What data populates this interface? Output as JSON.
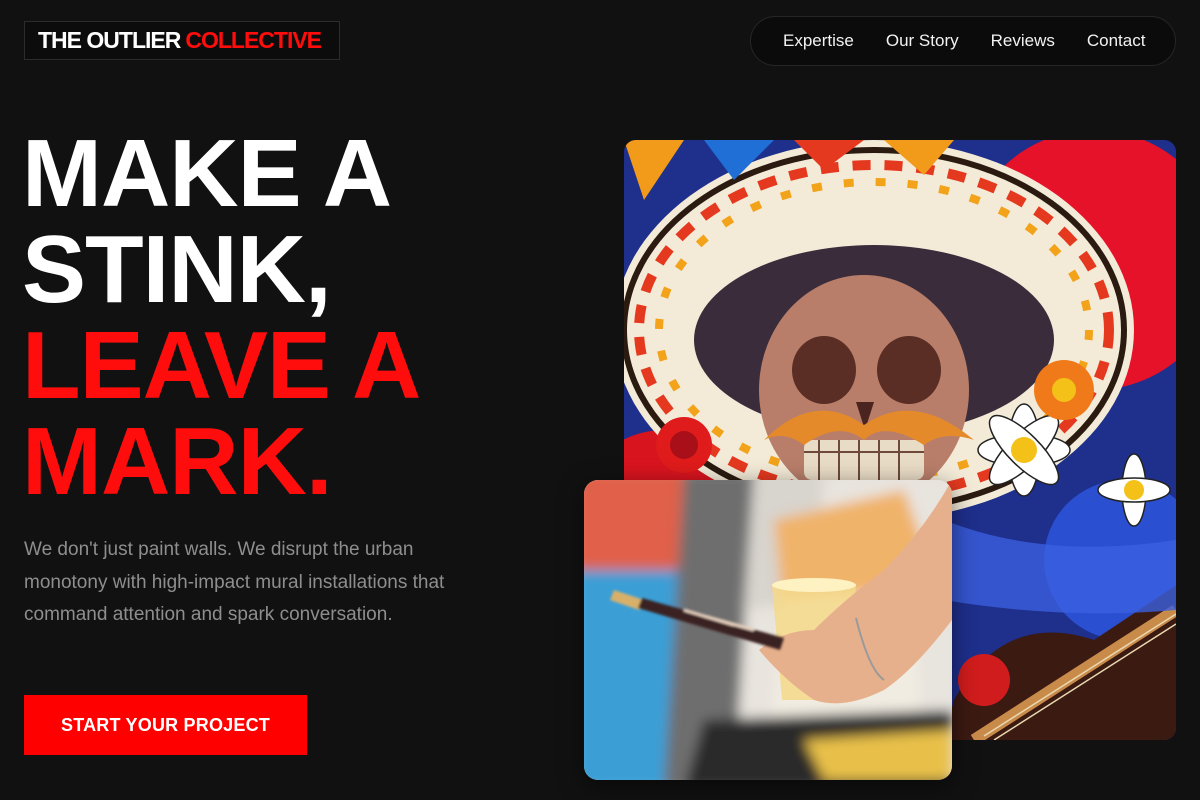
{
  "brand": {
    "name_part1": "THE OUTLIER",
    "name_part2": "COLLECTIVE"
  },
  "nav": {
    "items": [
      {
        "label": "Expertise"
      },
      {
        "label": "Our Story"
      },
      {
        "label": "Reviews"
      },
      {
        "label": "Contact"
      }
    ]
  },
  "hero": {
    "line1": "MAKE A",
    "line2": "STINK,",
    "line3": "LEAVE A",
    "line4": "MARK.",
    "description": "We don't just paint walls. We disrupt the urban monotony with high-impact mural installations that command attention and spark conversation.",
    "cta_label": "START YOUR PROJECT"
  },
  "colors": {
    "background": "#111112",
    "accent": "#ff0d0d",
    "text": "#ffffff",
    "muted": "#8e8e8e"
  },
  "images": {
    "mural": "skull-mural-image",
    "painter": "painter-hand-image"
  }
}
